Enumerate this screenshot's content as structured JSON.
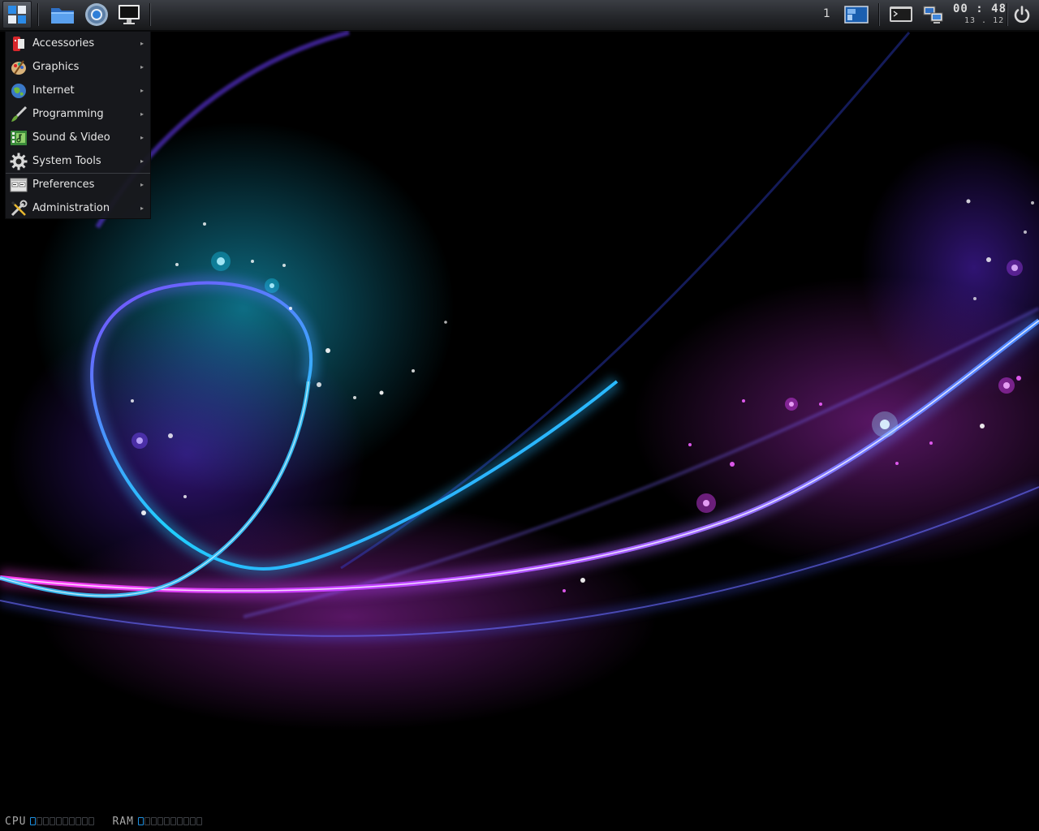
{
  "panel": {
    "workspace_number": "1",
    "clock": {
      "time": "00 : 48",
      "date": "13 . 12"
    },
    "icons": {
      "start": "start-menu-icon",
      "file_manager": "folder-icon",
      "browser": "chromium-icon",
      "desktop": "monitor-icon",
      "workspace_preview": "workspace-icon",
      "terminal": "terminal-icon",
      "network": "network-icon",
      "power": "power-icon"
    }
  },
  "menu": {
    "items": [
      {
        "label": "Accessories",
        "icon": "accessories-icon"
      },
      {
        "label": "Graphics",
        "icon": "graphics-icon"
      },
      {
        "label": "Internet",
        "icon": "globe-icon"
      },
      {
        "label": "Programming",
        "icon": "brush-icon"
      },
      {
        "label": "Sound & Video",
        "icon": "multimedia-icon"
      },
      {
        "label": "System Tools",
        "icon": "gear-icon"
      },
      {
        "label": "Preferences",
        "icon": "preferences-icon"
      },
      {
        "label": "Administration",
        "icon": "tools-icon"
      }
    ],
    "submenu_arrow": "▸"
  },
  "sysmon": {
    "cpu": {
      "label": "CPU",
      "level": 0.1
    },
    "ram": {
      "label": "RAM",
      "level": 0.1
    }
  },
  "colors": {
    "accent_blue": "#1e90e0",
    "wallpaper_cyan": "#19d4ff",
    "wallpaper_violet": "#8a3cff",
    "wallpaper_magenta": "#e23cf0"
  }
}
